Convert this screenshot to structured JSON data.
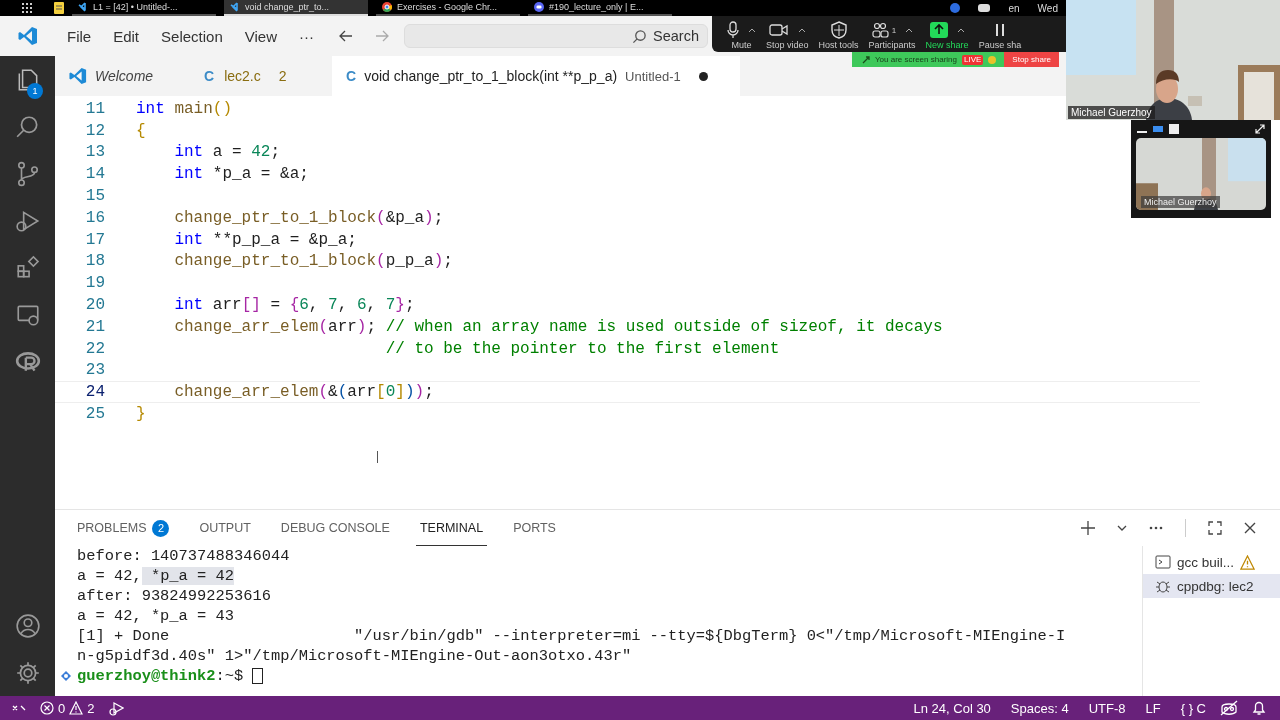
{
  "taskbar": {
    "windows": [
      {
        "label": "L1 = [42] • Untitled-...",
        "selected": false,
        "kind": "vscode"
      },
      {
        "label": "void change_ptr_to...",
        "selected": true,
        "kind": "vscode"
      },
      {
        "label": "Exercises - Google Chr...",
        "selected": false,
        "kind": "chrome"
      },
      {
        "label": "#190_lecture_only | E...",
        "selected": false,
        "kind": "discord"
      }
    ],
    "language": "en",
    "day": "Wed"
  },
  "menu": [
    "File",
    "Edit",
    "Selection",
    "View",
    "···"
  ],
  "search": {
    "placeholder": "Search"
  },
  "zoom_toolbar": {
    "buttons": [
      {
        "label": "Mute",
        "kind": "mic",
        "caret": true
      },
      {
        "label": "Stop video",
        "kind": "video",
        "caret": true
      },
      {
        "label": "Host tools",
        "kind": "shield",
        "caret": false
      },
      {
        "label": "Participants",
        "kind": "people",
        "caret": true,
        "count": "1"
      },
      {
        "label": "New share",
        "kind": "share",
        "caret": true
      },
      {
        "label": "Pause sha",
        "kind": "pause",
        "caret": false
      }
    ],
    "sharing_notice": "You are screen sharing",
    "live_badge": "LIVE",
    "stop_share": "Stop share"
  },
  "video": {
    "main_name": "Michael Guerzhoy",
    "floating_name": "Michael Guerzhoy"
  },
  "activity_bar": {
    "explorer_badge": "1"
  },
  "editor_tabs": [
    {
      "kind": "welcome",
      "label": "Welcome",
      "italic": true,
      "selected": false
    },
    {
      "kind": "file",
      "file_icon": "C",
      "label": "lec2.c",
      "italic": false,
      "badge": "2",
      "selected": false
    },
    {
      "kind": "file",
      "file_icon": "C",
      "label": "void change_ptr_to_1_block(int **p_p_a)",
      "description": "Untitled-1",
      "italic": false,
      "dirty": true,
      "selected": true
    }
  ],
  "code_lines": [
    {
      "num": "11",
      "current": false,
      "tokens": [
        {
          "kind": "kw",
          "text": "int "
        },
        {
          "kind": "fn",
          "text": "main"
        },
        {
          "kind": "b1",
          "text": "()"
        }
      ]
    },
    {
      "num": "12",
      "current": false,
      "tokens": [
        {
          "kind": "b1",
          "text": "{"
        }
      ]
    },
    {
      "num": "13",
      "current": false,
      "tokens": [
        {
          "kind": "kw",
          "text": "    int"
        },
        {
          "kind": "plain",
          "text": " a = "
        },
        {
          "kind": "num",
          "text": "42"
        },
        {
          "kind": "plain",
          "text": ";"
        }
      ]
    },
    {
      "num": "14",
      "current": false,
      "tokens": [
        {
          "kind": "kw",
          "text": "    int"
        },
        {
          "kind": "plain",
          "text": " *p_a = &a;"
        }
      ]
    },
    {
      "num": "15",
      "current": false
    },
    {
      "num": "16",
      "current": false,
      "tokens": [
        {
          "kind": "fn",
          "text": "    change_ptr_to_1_block"
        },
        {
          "kind": "b2",
          "text": "("
        },
        {
          "kind": "plain",
          "text": "&p_a"
        },
        {
          "kind": "b2",
          "text": ")"
        },
        {
          "kind": "plain",
          "text": ";"
        }
      ]
    },
    {
      "num": "17",
      "current": false,
      "tokens": [
        {
          "kind": "kw",
          "text": "    int"
        },
        {
          "kind": "plain",
          "text": " **p_p_a = &p_a;"
        }
      ]
    },
    {
      "num": "18",
      "current": false,
      "tokens": [
        {
          "kind": "fn",
          "text": "    change_ptr_to_1_block"
        },
        {
          "kind": "b2",
          "text": "("
        },
        {
          "kind": "plain",
          "text": "p_p_a"
        },
        {
          "kind": "b2",
          "text": ")"
        },
        {
          "kind": "plain",
          "text": ";"
        }
      ]
    },
    {
      "num": "19",
      "current": false
    },
    {
      "num": "20",
      "current": false,
      "tokens": [
        {
          "kind": "kw",
          "text": "    int"
        },
        {
          "kind": "plain",
          "text": " arr"
        },
        {
          "kind": "b2",
          "text": "[]"
        },
        {
          "kind": "plain",
          "text": " = "
        },
        {
          "kind": "b2",
          "text": "{"
        },
        {
          "kind": "num",
          "text": "6"
        },
        {
          "kind": "plain",
          "text": ", "
        },
        {
          "kind": "num",
          "text": "7"
        },
        {
          "kind": "plain",
          "text": ", "
        },
        {
          "kind": "num",
          "text": "6"
        },
        {
          "kind": "plain",
          "text": ", "
        },
        {
          "kind": "num",
          "text": "7"
        },
        {
          "kind": "b2",
          "text": "}"
        },
        {
          "kind": "plain",
          "text": ";"
        }
      ]
    },
    {
      "num": "21",
      "current": false,
      "tokens": [
        {
          "kind": "fn",
          "text": "    change_arr_elem"
        },
        {
          "kind": "b2",
          "text": "("
        },
        {
          "kind": "plain",
          "text": "arr"
        },
        {
          "kind": "b2",
          "text": ")"
        },
        {
          "kind": "plain",
          "text": "; "
        },
        {
          "kind": "cm",
          "text": "// when an array name is used outside of sizeof, it decays"
        }
      ]
    },
    {
      "num": "22",
      "current": false,
      "tokens": [
        {
          "kind": "cm",
          "text": "                          // to be the pointer to the first element"
        }
      ]
    },
    {
      "num": "23",
      "current": false
    },
    {
      "num": "24",
      "current": true,
      "tokens": [
        {
          "kind": "fn",
          "text": "    change_arr_elem"
        },
        {
          "kind": "b2",
          "text": "("
        },
        {
          "kind": "plain",
          "text": "&"
        },
        {
          "kind": "b3",
          "text": "("
        },
        {
          "kind": "plain",
          "text": "arr"
        },
        {
          "kind": "b1",
          "text": "["
        },
        {
          "kind": "num",
          "text": "0"
        },
        {
          "kind": "b1",
          "text": "]"
        },
        {
          "kind": "b3",
          "text": ")"
        },
        {
          "kind": "b2",
          "text": ")"
        },
        {
          "kind": "plain",
          "text": ";"
        }
      ]
    },
    {
      "num": "25",
      "current": false,
      "tokens": [
        {
          "kind": "b1",
          "text": "}"
        }
      ]
    }
  ],
  "panel_tabs": [
    {
      "label": "PROBLEMS",
      "badge": "2",
      "selected": false
    },
    {
      "label": "OUTPUT",
      "selected": false
    },
    {
      "label": "DEBUG CONSOLE",
      "selected": false
    },
    {
      "label": "TERMINAL",
      "selected": true
    },
    {
      "label": "PORTS",
      "selected": false
    }
  ],
  "terminal_lines": [
    [
      {
        "text": "before: 140737488346044",
        "selected": false
      }
    ],
    [
      {
        "text": "a = 42,",
        "selected": false
      },
      {
        "text": " *p_a = 42",
        "selected": true
      }
    ],
    [
      {
        "text": "after: 93824992253616",
        "selected": false
      }
    ],
    [
      {
        "text": "a = 42, *p_a = 43",
        "selected": false
      }
    ],
    [
      {
        "text": "[1] + Done                    \"/usr/bin/gdb\" --interpreter=mi --tty=${DbgTerm} 0<\"/tmp/Microsoft-MIEngine-I",
        "selected": false
      }
    ],
    [
      {
        "text": "n-g5pidf3d.40s\" 1>\"/tmp/Microsoft-MIEngine-Out-aon3otxo.43r\"",
        "selected": false
      }
    ]
  ],
  "prompt": {
    "user": "guerzhoy@think2",
    "path": ":~$"
  },
  "terminals": [
    {
      "label": "gcc buil...",
      "kind": "task",
      "warning": true,
      "selected": false
    },
    {
      "label": "cppdbg: lec2",
      "kind": "debug",
      "warning": false,
      "selected": true
    }
  ],
  "status": {
    "errors": "0",
    "warnings": "2",
    "position": "Ln 24, Col 30",
    "spaces": "Spaces: 4",
    "encoding": "UTF-8",
    "eol": "LF",
    "language": "C",
    "language_icon": "{ }"
  }
}
